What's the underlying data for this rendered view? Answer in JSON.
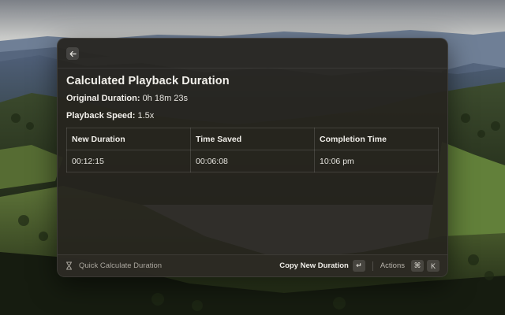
{
  "window": {
    "heading": "Calculated Playback Duration",
    "original_duration": {
      "label": "Original Duration:",
      "value": "0h 18m 23s"
    },
    "playback_speed": {
      "label": "Playback Speed:",
      "value": "1.5x"
    },
    "table": {
      "headers": [
        "New Duration",
        "Time Saved",
        "Completion Time"
      ],
      "rows": [
        [
          "00:12:15",
          "00:06:08",
          "10:06 pm"
        ]
      ]
    }
  },
  "footer": {
    "command_name": "Quick Calculate Duration",
    "primary_action": "Copy New Duration",
    "primary_shortcut": "↵",
    "actions_label": "Actions",
    "actions_shortcut_mod": "⌘",
    "actions_shortcut_key": "K"
  },
  "icons": {
    "back": "arrow-left-icon",
    "command": "hourglass-icon"
  }
}
